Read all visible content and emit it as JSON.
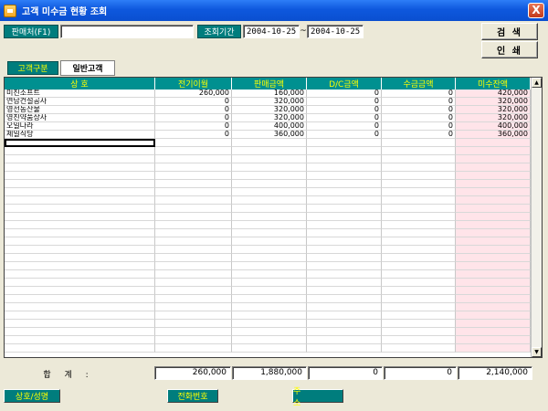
{
  "window": {
    "title": "고객 미수금 현황 조회",
    "close_glyph": "X"
  },
  "filters": {
    "seller_label": "판매처(F1)",
    "seller_value": "",
    "period_label": "조회기간",
    "date_from": "2004-10-25",
    "date_sep": "~",
    "date_to": "2004-10-25"
  },
  "buttons": {
    "search": "검 색",
    "print": "인 쇄"
  },
  "tabs": {
    "customer_type_label": "고객구분",
    "general_customer": "일반고객"
  },
  "table": {
    "columns": [
      "상 호",
      "전기이월",
      "판매금액",
      "D/C금액",
      "수금금액",
      "미수잔액"
    ],
    "rows": [
      [
        "미진소프트",
        "260,000",
        "160,000",
        "0",
        "0",
        "420,000"
      ],
      [
        "연남건설공사",
        "0",
        "320,000",
        "0",
        "0",
        "320,000"
      ],
      [
        "영선동산물",
        "0",
        "320,000",
        "0",
        "0",
        "320,000"
      ],
      [
        "영진약품상사",
        "0",
        "320,000",
        "0",
        "0",
        "320,000"
      ],
      [
        "오일나라",
        "0",
        "400,000",
        "0",
        "0",
        "400,000"
      ],
      [
        "제일식당",
        "0",
        "360,000",
        "0",
        "0",
        "360,000"
      ]
    ]
  },
  "totals": {
    "label": "합 계 :",
    "prev": "260,000",
    "sales": "1,880,000",
    "dc": "0",
    "collected": "0",
    "balance": "2,140,000"
  },
  "footer": {
    "company_name": "상호/성명",
    "phone": "전화번호",
    "address": "주 소"
  }
}
